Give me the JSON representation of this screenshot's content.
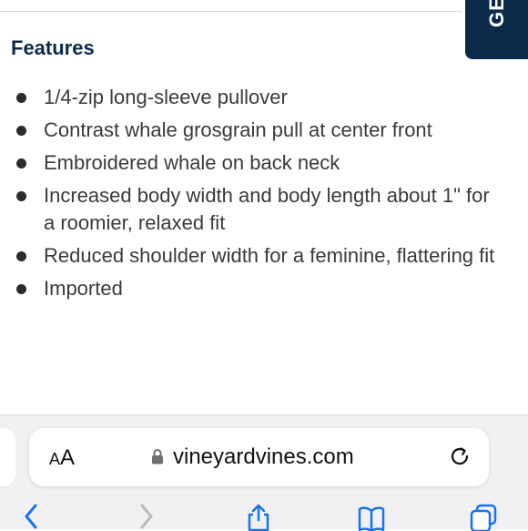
{
  "floating_tab": {
    "label": "GET"
  },
  "features": {
    "title": "Features",
    "items": [
      "1/4-zip long-sleeve pullover",
      "Contrast whale grosgrain pull at center front",
      "Embroidered whale on back neck",
      "Increased body width and body length about 1\" for a roomier, relaxed fit",
      "Reduced shoulder width for a feminine, flattering fit",
      "Imported"
    ]
  },
  "browser": {
    "text_size_label_small": "A",
    "text_size_label_large": "A",
    "url": "vineyardvines.com",
    "icons": [
      "lock-icon",
      "reload-icon",
      "back-icon",
      "forward-icon",
      "share-icon",
      "bookmarks-icon",
      "tabs-icon"
    ]
  },
  "colors": {
    "brand_navy": "#0b2a4a",
    "toolbar_blue": "#1a73e8"
  }
}
